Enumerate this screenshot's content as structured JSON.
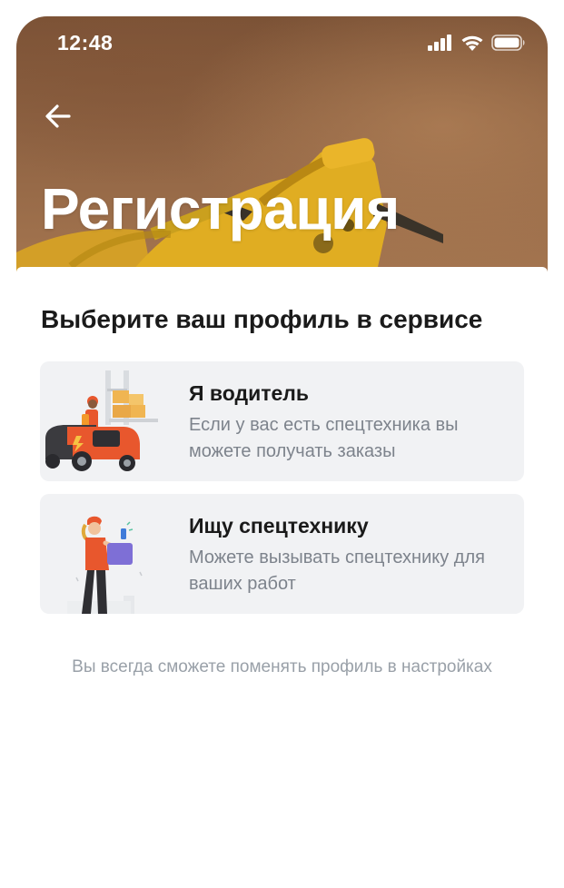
{
  "status_bar": {
    "time": "12:48",
    "icons": [
      "signal-icon",
      "wifi-icon",
      "battery-icon"
    ]
  },
  "header": {
    "back_icon": "arrow-left-icon",
    "title": "Регистрация"
  },
  "main": {
    "section_title": "Выберите ваш профиль в сервисе",
    "options": [
      {
        "title": "Я водитель",
        "description": "Если у вас есть спецтехника вы можете получать заказы",
        "illustration": "forklift-driver-illustration"
      },
      {
        "title": "Ищу спецтехнику",
        "description": "Можете вызывать спецтехнику для ваших работ",
        "illustration": "customer-phone-illustration"
      }
    ],
    "hint": "Вы всегда сможете поменять профиль в настройках"
  },
  "colors": {
    "accent": "#e8572d",
    "card_background": "#f1f2f4",
    "secondary_text": "#7d838c",
    "hint_text": "#99a0a8"
  }
}
